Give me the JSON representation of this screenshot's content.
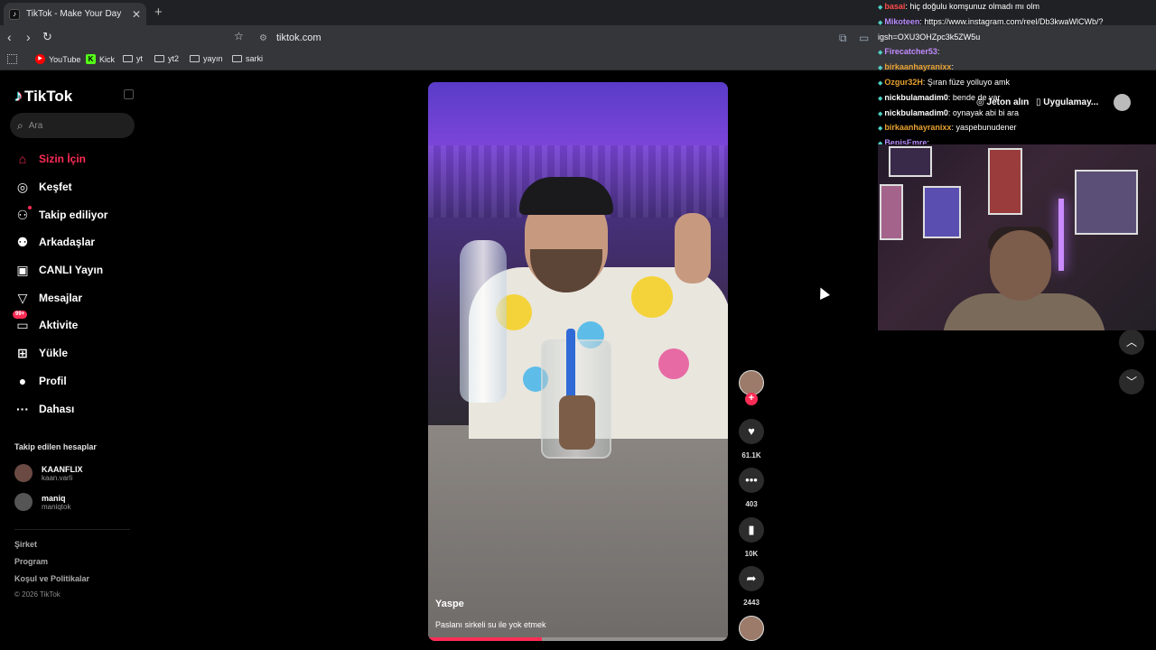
{
  "browser": {
    "tab_title": "TikTok - Make Your Day",
    "tab_icon": "tiktok-icon",
    "tab_close": "✕",
    "new_tab": "+",
    "url": "tiktok.com",
    "window_controls": {
      "minimize": "–",
      "maximize": "□",
      "close": "✕"
    }
  },
  "bookmarks": [
    {
      "label": "YouTube",
      "icon": "youtube-icon"
    },
    {
      "label": "Kick",
      "icon": "kick-icon"
    },
    {
      "label": "yt",
      "icon": "folder-icon"
    },
    {
      "label": "yt2",
      "icon": "folder-icon"
    },
    {
      "label": "yayın",
      "icon": "folder-icon"
    },
    {
      "label": "sarki",
      "icon": "folder-icon"
    }
  ],
  "sidebar": {
    "logo": "TikTok",
    "search_placeholder": "Ara",
    "nav": [
      {
        "label": "Sizin İçin",
        "icon": "home-icon",
        "active": true
      },
      {
        "label": "Keşfet",
        "icon": "compass-icon"
      },
      {
        "label": "Takip ediliyor",
        "icon": "following-icon"
      },
      {
        "label": "Arkadaşlar",
        "icon": "friends-icon"
      },
      {
        "label": "CANLI Yayın",
        "icon": "live-icon"
      },
      {
        "label": "Mesajlar",
        "icon": "messages-icon"
      },
      {
        "label": "Aktivite",
        "icon": "activity-icon",
        "badge": "99+"
      },
      {
        "label": "Yükle",
        "icon": "upload-icon"
      },
      {
        "label": "Profil",
        "icon": "profile-icon"
      },
      {
        "label": "Dahası",
        "icon": "more-icon"
      }
    ],
    "following_header": "Takip edilen hesaplar",
    "following": [
      {
        "name": "KAANFLIX",
        "handle": "kaan.varli"
      },
      {
        "name": "maniq",
        "handle": "maniqtok"
      }
    ],
    "footer_links": [
      "Şirket",
      "Program",
      "Koşul ve Politikalar"
    ],
    "copyright": "© 2026 TikTok"
  },
  "video": {
    "creator": "Yaspe",
    "description": "Paslanı sirkeli su ile yok etmek",
    "progress": 0.38
  },
  "actions": {
    "likes": "61.1K",
    "comments": "403",
    "saves": "10K",
    "shares": "2443",
    "follow_plus": "+"
  },
  "overlay": {
    "get_coins": "Jeton alın",
    "get_app": "Uygulamay..."
  },
  "chat": [
    {
      "user": "basai",
      "text": ": hiç doğulu komşunuz olmadı mı olm",
      "color": "#ff4a4a"
    },
    {
      "user": "Mikoteen",
      "text": ": https://www.instagram.com/reel/Db3kwaWlCWb/?",
      "color": "#b98cff"
    },
    {
      "user": "",
      "text": "igsh=OXU3OHZpc3k5ZW5u",
      "color": "#ffffff"
    },
    {
      "user": "Firecatcher53",
      "text": ":",
      "color": "#c18bff"
    },
    {
      "user": "birkaanhayranixx",
      "text": ":",
      "color": "#e9a332"
    },
    {
      "user": "Ozgur32H",
      "text": ": Şıran füze yolluyo amk",
      "color": "#e9a332"
    },
    {
      "user": "nickbulamadim0",
      "text": ": bende de var",
      "color": "#ffffff"
    },
    {
      "user": "nickbulamadim0",
      "text": ": oynayak abi bi ara",
      "color": "#ffffff"
    },
    {
      "user": "birkaanhayranixx",
      "text": ": yaspebunudener",
      "color": "#e9a332"
    },
    {
      "user": "BepisEmre",
      "text": ":",
      "color": "#b98cff"
    }
  ],
  "colors": {
    "accent": "#fe2c55",
    "background": "#000000",
    "chrome": "#35363a"
  }
}
